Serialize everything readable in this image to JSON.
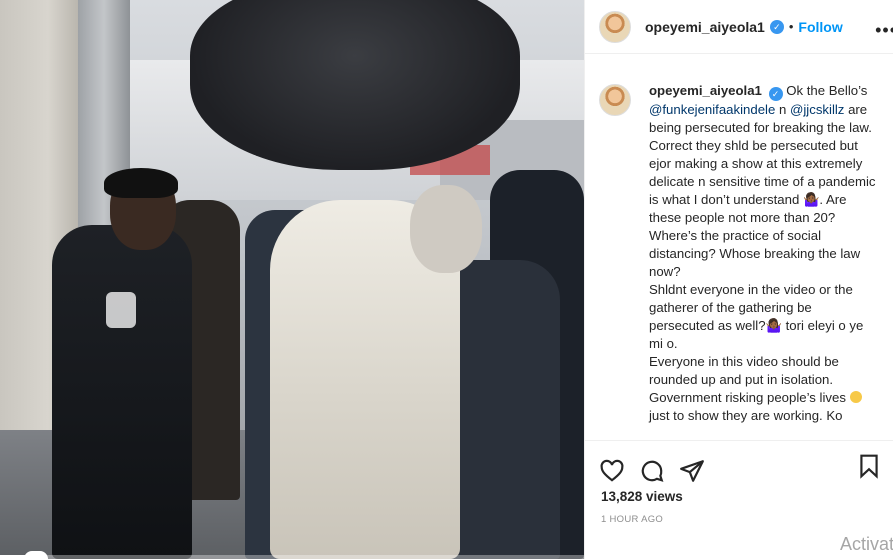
{
  "post": {
    "username": "opeyemi_aiyeola1",
    "follow_label": "Follow",
    "separator": "•",
    "more_label": "•••"
  },
  "caption": {
    "username": "opeyemi_aiyeola1",
    "lines": [
      " Ok the Bello’s",
      "@funkejenifaakindele",
      " n ",
      "@jjcskillz",
      " are being persecuted for breaking the law. Correct they shld be persecuted but ejor making a show at this extremely delicate n sensitive time of a pandemic is what I don’t understand 🤷🏾‍♀️. Are these people not more than 20?",
      "Where’s the practice of social distancing? Whose breaking the law now?",
      "Shldnt everyone in the video or the gatherer of the gathering be persecuted as well?🤷🏾‍♀️ tori eleyi o ye mi o.",
      "Everyone in this video should be rounded up and put in isolation. Government risking people’s lives",
      "just to show they are working. Ko"
    ]
  },
  "stats": {
    "views": "13,828 views",
    "time_ago": "1 HOUR AGO"
  },
  "watermark": "Activat",
  "icons": {
    "like": "heart-icon",
    "comment": "comment-icon",
    "share": "share-icon",
    "save": "bookmark-icon",
    "verified": "verified-badge-icon"
  },
  "video": {
    "progress": 0.05
  },
  "colors": {
    "accent": "#0095f6",
    "verified": "#3897f0",
    "text": "#262626",
    "muted": "#8e8e8e",
    "mention": "#00376b"
  }
}
